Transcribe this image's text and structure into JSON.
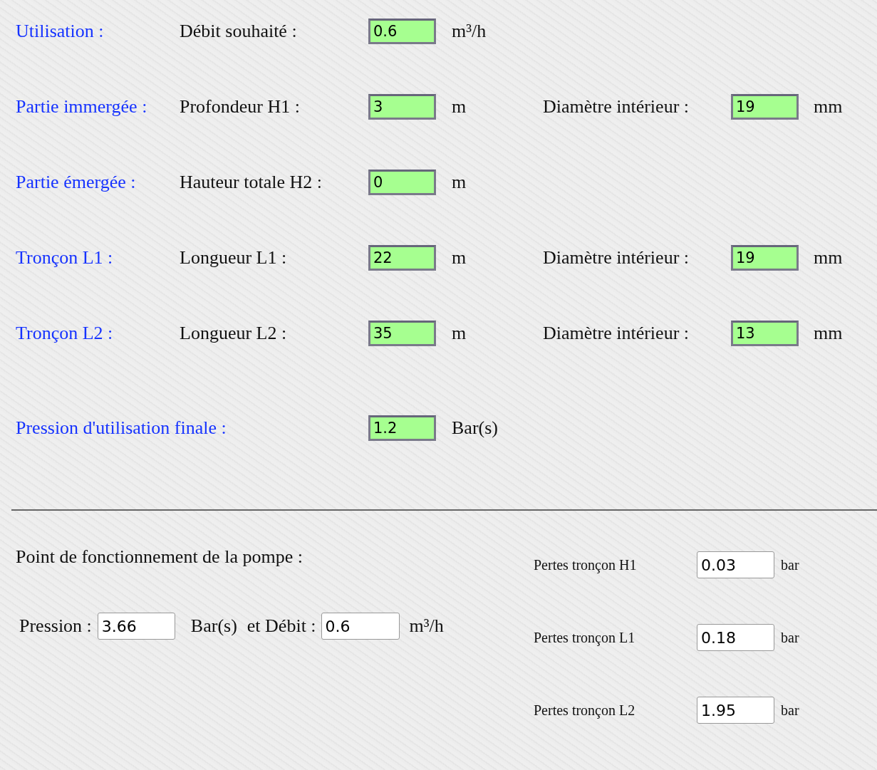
{
  "rows": [
    {
      "kind": "section",
      "section": "Utilisation :",
      "fields": [
        {
          "label": "Débit souhaité :",
          "value": "0.6",
          "unit": "m³/h"
        }
      ]
    },
    {
      "kind": "section",
      "section": "Partie immergée :",
      "fields": [
        {
          "label": "Profondeur H1 :",
          "value": "3",
          "unit": "m"
        },
        {
          "label": "Diamètre intérieur :",
          "value": "19",
          "unit": "mm"
        }
      ]
    },
    {
      "kind": "section",
      "section": "Partie émergée :",
      "fields": [
        {
          "label": "Hauteur totale H2 :",
          "value": "0",
          "unit": "m"
        }
      ]
    },
    {
      "kind": "section",
      "section": "Tronçon L1 :",
      "fields": [
        {
          "label": "Longueur L1 :",
          "value": "22",
          "unit": "m"
        },
        {
          "label": "Diamètre intérieur :",
          "value": "19",
          "unit": "mm"
        }
      ]
    },
    {
      "kind": "section",
      "section": "Tronçon L2 :",
      "fields": [
        {
          "label": "Longueur L2 :",
          "value": "35",
          "unit": "m"
        },
        {
          "label": "Diamètre intérieur :",
          "value": "13",
          "unit": "mm"
        }
      ]
    },
    {
      "kind": "wide",
      "section": "Pression d'utilisation finale :",
      "fields": [
        {
          "value": "1.2",
          "unit": "Bar(s)"
        }
      ]
    }
  ],
  "operating_point": {
    "title": "Point de fonctionnement de la pompe :",
    "pressure": {
      "label": "Pression :",
      "value": "3.66",
      "unit": "Bar(s)"
    },
    "flow": {
      "label": "et Débit :",
      "value": "0.6",
      "unit": "m³/h"
    }
  },
  "losses": [
    {
      "label": "Pertes tronçon H1",
      "value": "0.03",
      "unit": "bar"
    },
    {
      "label": "Pertes tronçon L1",
      "value": "0.18",
      "unit": "bar"
    },
    {
      "label": "Pertes tronçon L2",
      "value": "1.95",
      "unit": "bar"
    }
  ]
}
